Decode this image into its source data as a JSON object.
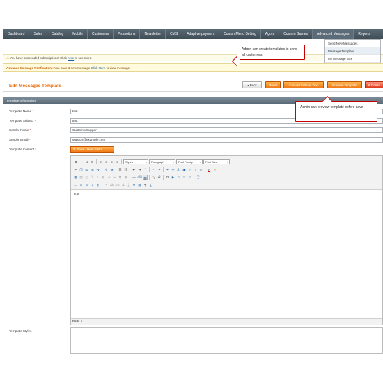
{
  "nav": {
    "items": [
      "Dashboard",
      "Sales",
      "Catalog",
      "Mobile",
      "Customers",
      "Promotions",
      "Newsletter",
      "CMS",
      "Adaptive payment",
      "CustomMenu Setting",
      "Agora",
      "Custom Games",
      "Advanced Messages",
      "Reports"
    ]
  },
  "dropdown": {
    "items": [
      "Send New Messages",
      "Message Template",
      "My Message Box"
    ]
  },
  "notice": {
    "prefix": "You have suspended subscriptions! Click",
    "link": "here",
    "suffix": "to see more."
  },
  "advance_notice": {
    "label": "Advance Message Notification :",
    "prefix": "You have",
    "count": "1",
    "middle": "new message",
    "link": "Click Here",
    "suffix": "to view message."
  },
  "header": {
    "title": "Edit Messages Template",
    "back_label": "Back",
    "reset_label": "Reset",
    "convert_label": "Convert to Plain Text",
    "preview_label": "Preview Template",
    "delete_label": "Delete"
  },
  "section": {
    "title": "Template Information"
  },
  "form": {
    "template_name_label": "Template Name",
    "template_name_value": "test",
    "template_subject_label": "Template Subject",
    "template_subject_value": "test",
    "sender_name_label": "Sender Name",
    "sender_name_value": "CustomerSupport",
    "sender_email_label": "Sender Email",
    "sender_email_value": "support@example.com",
    "template_content_label": "Template Content",
    "required_mark": "*",
    "show_hide_label": "Show / Hide Editor",
    "template_styles_label": "Template Styles"
  },
  "editor": {
    "styles_select": "Styles",
    "paragraph_select": "Paragraph",
    "font_family_select": "Font Family",
    "font_size_select": "Font Size",
    "content": "test",
    "path": "Path: p"
  },
  "callouts": {
    "create_text": "Admin can create templates to send all customers.",
    "preview_text": "Admin can preview template before save"
  },
  "colors": {
    "accent": "#f07a16",
    "title": "#e26703",
    "nav_bg": "#3f4d57",
    "callout_border": "#c40000"
  }
}
